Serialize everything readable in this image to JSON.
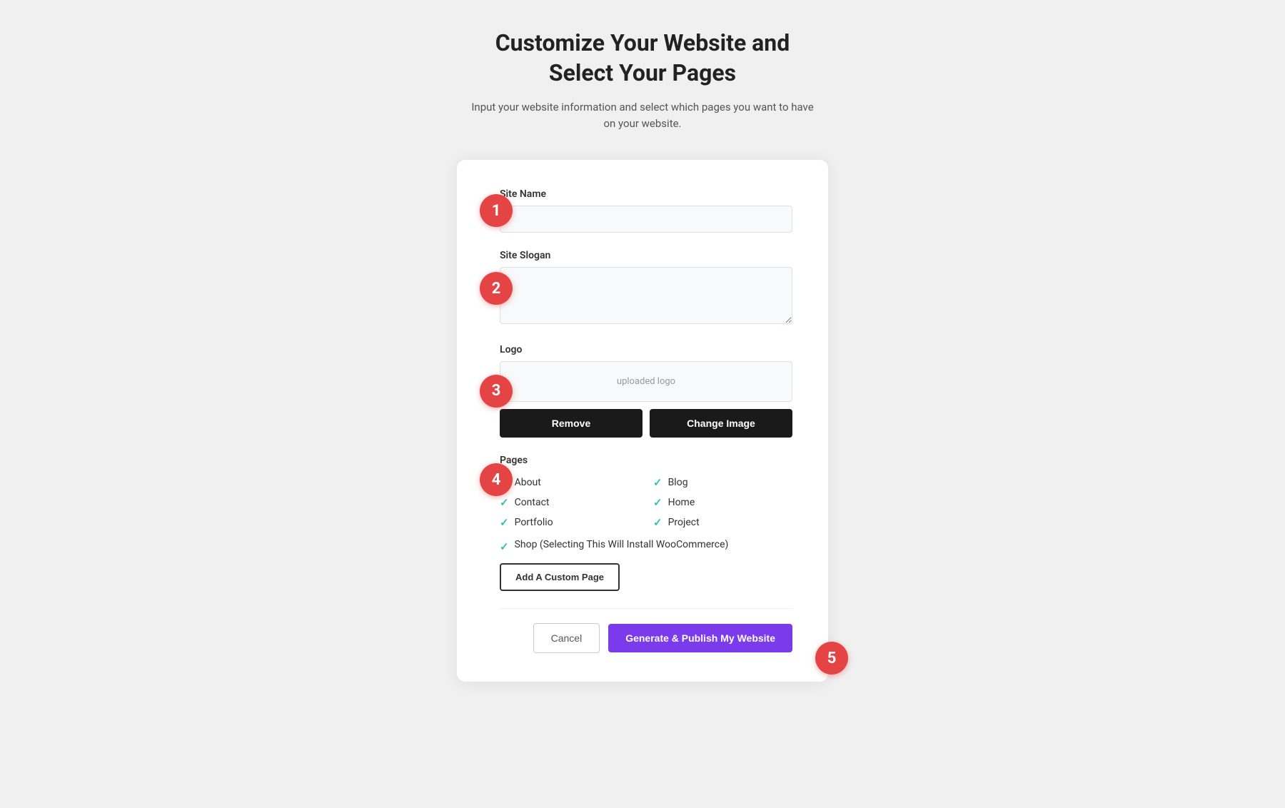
{
  "header": {
    "title": "Customize Your Website and\nSelect Your Pages",
    "subtitle": "Input your website information and select which pages you want to have\non your website."
  },
  "form": {
    "site_name_label": "Site Name",
    "site_name_placeholder": "",
    "site_slogan_label": "Site Slogan",
    "site_slogan_placeholder": "",
    "logo_label": "Logo",
    "logo_preview_text": "uploaded logo",
    "remove_button": "Remove",
    "change_image_button": "Change Image",
    "pages_label": "Pages",
    "pages": [
      {
        "name": "About",
        "checked": true
      },
      {
        "name": "Blog",
        "checked": true
      },
      {
        "name": "Contact",
        "checked": true
      },
      {
        "name": "Home",
        "checked": true
      },
      {
        "name": "Portfolio",
        "checked": true
      },
      {
        "name": "Project",
        "checked": true
      }
    ],
    "shop_page": {
      "name": "Shop (Selecting This Will Install WooCommerce)",
      "checked": true
    },
    "add_custom_page_button": "Add A Custom Page",
    "cancel_button": "Cancel",
    "generate_button": "Generate & Publish My Website"
  },
  "steps": {
    "step1": "1",
    "step2": "2",
    "step3": "3",
    "step4": "4",
    "step5": "5"
  }
}
